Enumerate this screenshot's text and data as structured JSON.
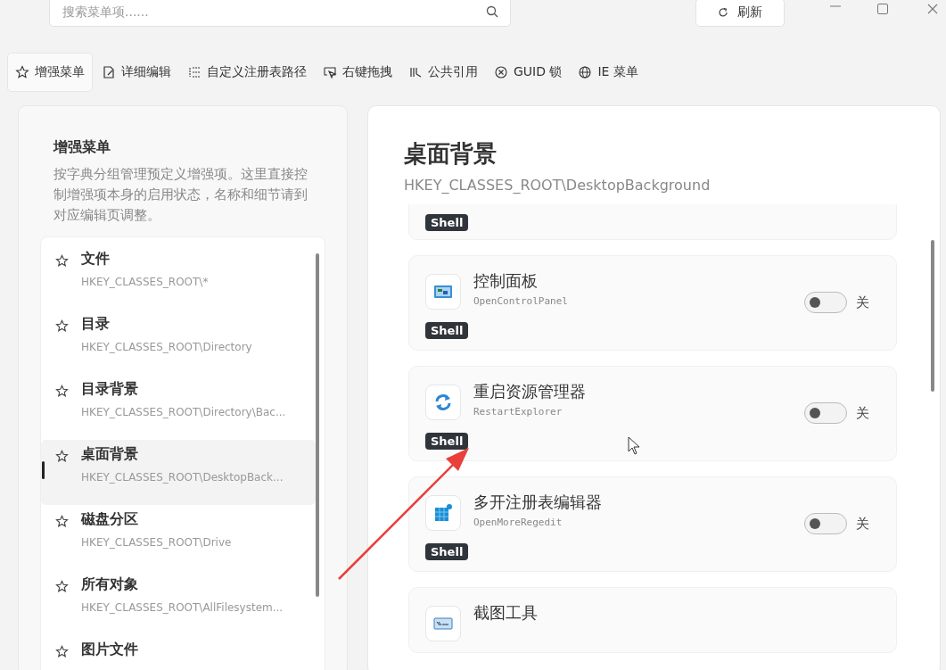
{
  "search": {
    "placeholder": "搜索菜单项......"
  },
  "refresh_button": {
    "label": "刷新"
  },
  "tabs": [
    {
      "label": "增强菜单",
      "selected": true
    },
    {
      "label": "详细编辑",
      "selected": false
    },
    {
      "label": "自定义注册表路径",
      "selected": false
    },
    {
      "label": "右键拖拽",
      "selected": false
    },
    {
      "label": "公共引用",
      "selected": false
    },
    {
      "label": "GUID 锁",
      "selected": false
    },
    {
      "label": "IE 菜单",
      "selected": false
    }
  ],
  "sidebar": {
    "title": "增强菜单",
    "description": "按字典分组管理预定义增强项。这里直接控制增强项本身的启用状态，名称和细节请到对应编辑页调整。",
    "items": [
      {
        "name": "文件",
        "path": "HKEY_CLASSES_ROOT\\*",
        "selected": false
      },
      {
        "name": "目录",
        "path": "HKEY_CLASSES_ROOT\\Directory",
        "selected": false
      },
      {
        "name": "目录背景",
        "path": "HKEY_CLASSES_ROOT\\Directory\\Bac...",
        "selected": false
      },
      {
        "name": "桌面背景",
        "path": "HKEY_CLASSES_ROOT\\DesktopBack...",
        "selected": true
      },
      {
        "name": "磁盘分区",
        "path": "HKEY_CLASSES_ROOT\\Drive",
        "selected": false
      },
      {
        "name": "所有对象",
        "path": "HKEY_CLASSES_ROOT\\AllFilesystem...",
        "selected": false
      },
      {
        "name": "图片文件",
        "selected": false
      }
    ]
  },
  "detail": {
    "title": "桌面背景",
    "path": "HKEY_CLASSES_ROOT\\DesktopBackground",
    "entries": [
      {
        "kind": "clipped",
        "tag": "Shell"
      },
      {
        "kind": "full",
        "name": "控制面板",
        "id": "OpenControlPanel",
        "tag": "Shell",
        "on": false,
        "state_label": "关"
      },
      {
        "kind": "full",
        "name": "重启资源管理器",
        "id": "RestartExplorer",
        "tag": "Shell",
        "on": false,
        "state_label": "关"
      },
      {
        "kind": "full",
        "name": "多开注册表编辑器",
        "id": "OpenMoreRegedit",
        "tag": "Shell",
        "on": false,
        "state_label": "关"
      },
      {
        "kind": "bottom",
        "name": "截图工具"
      }
    ]
  }
}
